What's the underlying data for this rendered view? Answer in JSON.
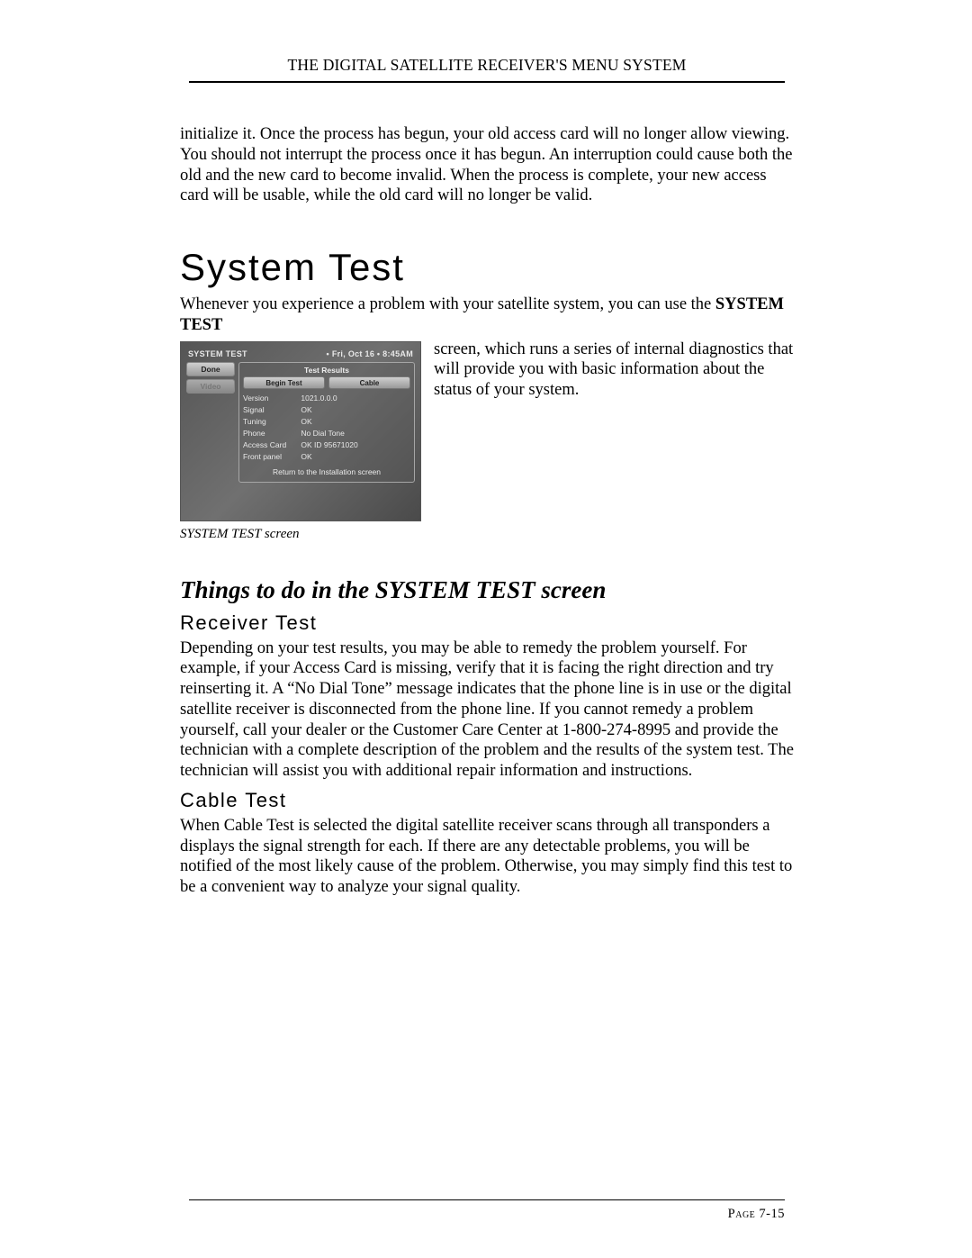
{
  "header": {
    "running_head": "THE DIGITAL SATELLITE RECEIVER'S MENU SYSTEM"
  },
  "intro_para": "initialize it. Once the process has begun, your old access card will no longer allow viewing. You should not interrupt the process once it has begun. An interruption could cause both the old and the new card to become invalid. When the process is complete, your new access card will be usable, while the old card will no longer be valid.",
  "section1": {
    "title": "System Test",
    "lead_pre": "Whenever you experience a problem with your satellite system, you can use the ",
    "lead_bold": "SYSTEM TEST",
    "wrap_text": "screen, which runs a series of internal diagnostics that will provide you with basic information about the status of your system.",
    "caption": "SYSTEM TEST screen"
  },
  "screenshot": {
    "title": "SYSTEM TEST",
    "datetime": "Fri, Oct 16 • 8:45AM",
    "left_tabs": [
      "Done",
      "Video"
    ],
    "panel_title": "Test Results",
    "buttons": [
      "Begin Test",
      "Cable"
    ],
    "rows": [
      {
        "k": "Version",
        "v": "1021.0.0.0"
      },
      {
        "k": "Signal",
        "v": "OK"
      },
      {
        "k": "Tuning",
        "v": "OK"
      },
      {
        "k": "Phone",
        "v": "No Dial Tone"
      },
      {
        "k": "Access Card",
        "v": "OK ID 95671020"
      },
      {
        "k": "Front panel",
        "v": "OK"
      }
    ],
    "footer": "Return to the Installation screen"
  },
  "section2": {
    "title": "Things to do in the SYSTEM TEST screen",
    "sub1_title": "Receiver Test",
    "sub1_body": "Depending on your test results, you may be able to remedy the problem yourself. For example, if your Access Card is missing, verify that it is facing the right direction and try reinserting it. A “No Dial Tone” message indicates that the phone line is in use or the digital satellite receiver is disconnected from the phone line. If you cannot remedy a problem yourself, call your dealer or the Customer Care Center at 1-800-274-8995 and provide the technician with a complete description of the problem and the results of the system test. The technician will assist you with additional repair information and instructions.",
    "sub2_title": "Cable Test",
    "sub2_body": "When Cable Test is selected the digital satellite receiver scans through all transponders a displays the signal strength for each. If there are any detectable problems, you will be notified of the most likely cause of the problem. Otherwise, you may simply find this test to be a convenient way to analyze your signal quality."
  },
  "footer": {
    "page_label": "Page",
    "page_number": "7-15"
  }
}
